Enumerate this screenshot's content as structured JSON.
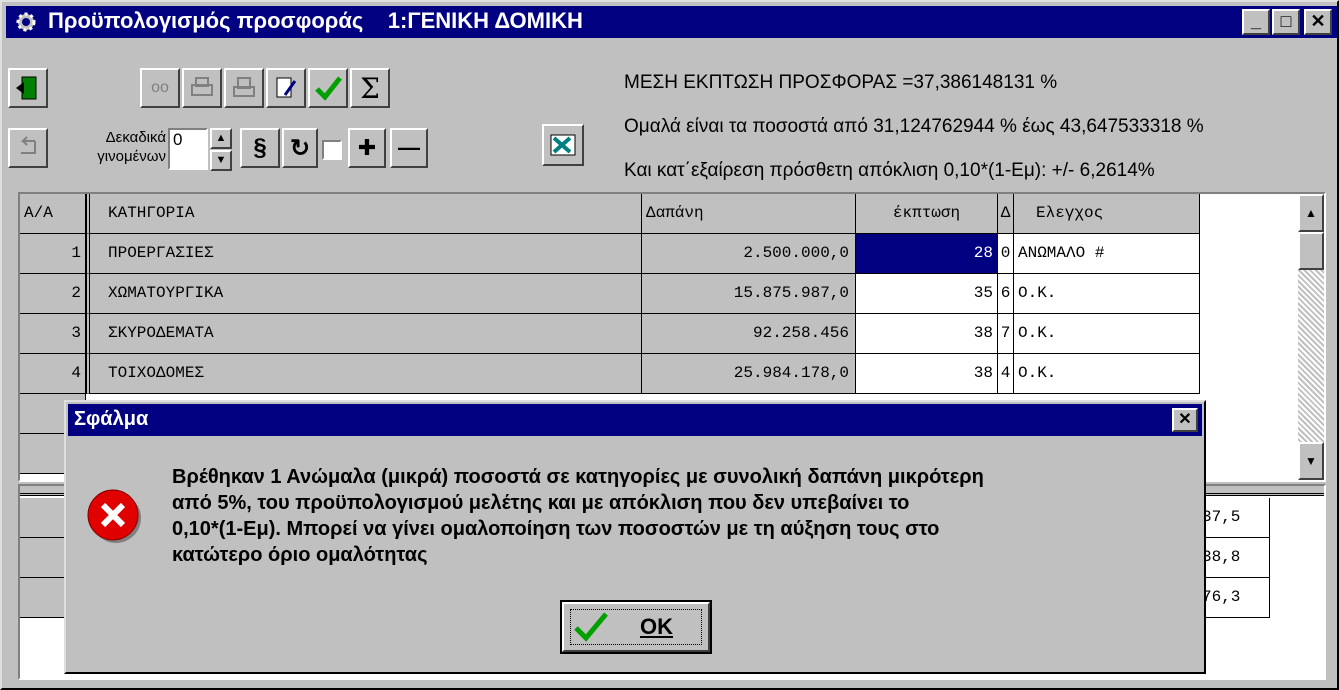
{
  "window": {
    "title": "Προϋπολογισμός προσφοράς    1:ΓΕΝΙΚΗ ΔΟΜΙΚΗ"
  },
  "toolbar": {
    "decimals_label_1": "Δεκαδικά",
    "decimals_label_2": "γινομένων",
    "decimals_value": "0",
    "sigma_label": "Σ"
  },
  "info": {
    "line1": "ΜΕΣΗ ΕΚΠΤΩΣΗ ΠΡΟΣΦΟΡΑΣ =37,386148131 %",
    "line2": "Ομαλά είναι τα ποσοστά από 31,124762944 % έως 43,647533318 %",
    "line3": "Και κατ΄εξαίρεση πρόσθετη απόκλιση 0,10*(1-Εμ): +/-   6,2614%"
  },
  "table": {
    "headers": {
      "aa": "Α/Α",
      "category": "ΚΑΤΗΓΟΡΙΑ",
      "cost": "Δαπάνη",
      "discount": "έκπτωση",
      "d": "Δ",
      "check": "Ελεγχος"
    },
    "rows": [
      {
        "aa": "1",
        "category": "ΠΡΟΕΡΓΑΣΙΕΣ",
        "cost": "2.500.000,0",
        "discount": "28",
        "d": "0",
        "check": "ΑΝΩΜΑΛΟ #"
      },
      {
        "aa": "2",
        "category": "ΧΩΜΑΤΟΥΡΓΙΚΑ",
        "cost": "15.875.987,0",
        "discount": "35",
        "d": "6",
        "check": "Ο.Κ."
      },
      {
        "aa": "3",
        "category": "ΣΚΥΡΟΔΕΜΑΤΑ",
        "cost": "92.258.456",
        "discount": "38",
        "d": "7",
        "check": "Ο.Κ."
      },
      {
        "aa": "4",
        "category": "ΤΟΙΧΟΔΟΜΕΣ",
        "cost": "25.984.178,0",
        "discount": "38",
        "d": "4",
        "check": "Ο.Κ."
      }
    ]
  },
  "summary": {
    "values": [
      "37,5",
      "38,8",
      "76,3"
    ]
  },
  "dialog": {
    "title": "Σφάλμα",
    "message_lines": [
      "Βρέθηκαν 1 Ανώμαλα (μικρά) ποσοστά σε κατηγορίες με συνολική δαπάνη μικρότερη",
      "από 5%, του προϋπολογισμού μελέτης και με απόκλιση που δεν υπεβαίνει το",
      "0,10*(1-Εμ). Μπορεί να γίνει ομαλοποίηση των ποσοστών με τη αύξηση τους  στο",
      "κατώτερο όριο ομαλότητας"
    ],
    "ok_label": "OK"
  },
  "colors": {
    "titlebar": "#000080",
    "selection": "#000080",
    "error_icon": "#e00000",
    "check_icon": "#00a000"
  }
}
